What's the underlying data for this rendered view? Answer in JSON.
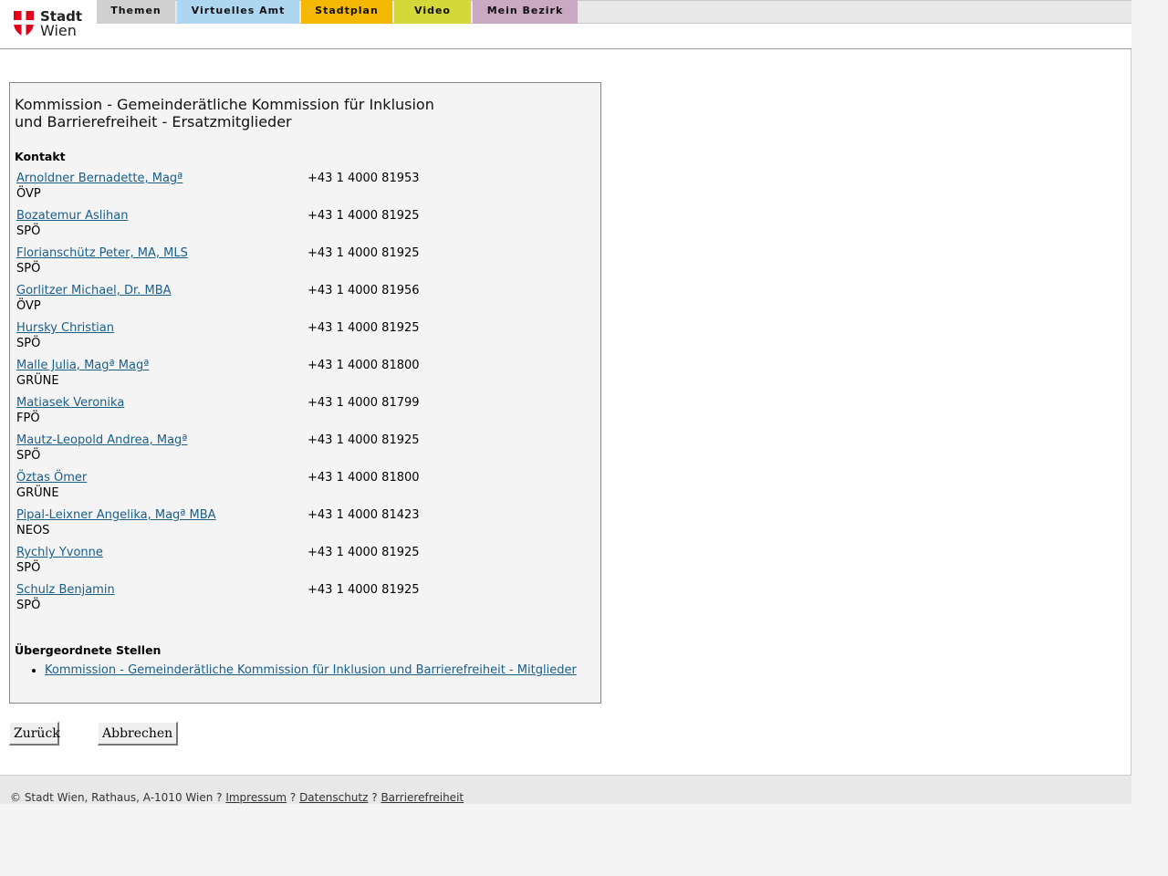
{
  "header": {
    "logo": {
      "line1": "Stadt",
      "line2": "Wien",
      "color": "#e2001a"
    },
    "tabs": [
      {
        "label": "Themen",
        "color": "#d0d0d0"
      },
      {
        "label": "Virtuelles Amt",
        "color": "#aed6f1"
      },
      {
        "label": "Stadtplan",
        "color": "#f5b800"
      },
      {
        "label": "Video",
        "color": "#d4d93a"
      },
      {
        "label": "Mein Bezirk",
        "color": "#c9a9c1"
      }
    ]
  },
  "main": {
    "title": "Kommission - Gemeinderätliche Kommission für Inklusion und Barrierefreiheit - Ersatzmitglieder",
    "contact_heading": "Kontakt",
    "contacts": [
      {
        "name": "Arnoldner Bernadette, Magª",
        "party": "ÖVP",
        "phone": "+43 1 4000 81953"
      },
      {
        "name": "Bozatemur Aslihan",
        "party": "SPÖ",
        "phone": "+43 1 4000 81925"
      },
      {
        "name": "Florianschütz Peter, MA, MLS",
        "party": "SPÖ",
        "phone": "+43 1 4000 81925"
      },
      {
        "name": "Gorlitzer Michael, Dr. MBA",
        "party": "ÖVP",
        "phone": "+43 1 4000 81956"
      },
      {
        "name": "Hursky Christian",
        "party": "SPÖ",
        "phone": "+43 1 4000 81925"
      },
      {
        "name": "Malle Julia, Magª Magª",
        "party": "GRÜNE",
        "phone": "+43 1 4000 81800"
      },
      {
        "name": "Matiasek Veronika",
        "party": "FPÖ",
        "phone": "+43 1 4000 81799"
      },
      {
        "name": "Mautz-Leopold Andrea, Magª",
        "party": "SPÖ",
        "phone": "+43 1 4000 81925"
      },
      {
        "name": "Öztas Ömer",
        "party": "GRÜNE",
        "phone": "+43 1 4000 81800"
      },
      {
        "name": "Pipal-Leixner Angelika, Magª MBA",
        "party": "NEOS",
        "phone": "+43 1 4000 81423"
      },
      {
        "name": "Rychly Yvonne",
        "party": "SPÖ",
        "phone": "+43 1 4000 81925"
      },
      {
        "name": "Schulz Benjamin",
        "party": "SPÖ",
        "phone": "+43 1 4000 81925"
      }
    ],
    "parent_heading": "Übergeordnete Stellen",
    "parent_links": [
      "Kommission - Gemeinderätliche Kommission für Inklusion und Barrierefreiheit - Mitglieder"
    ]
  },
  "buttons": {
    "back": "Zurück",
    "cancel": "Abbrechen"
  },
  "footer": {
    "copyright": "© Stadt Wien, Rathaus, A-1010 Wien ?",
    "sep": "?",
    "links": [
      "Impressum",
      "Datenschutz",
      "Barrierefreiheit"
    ]
  }
}
